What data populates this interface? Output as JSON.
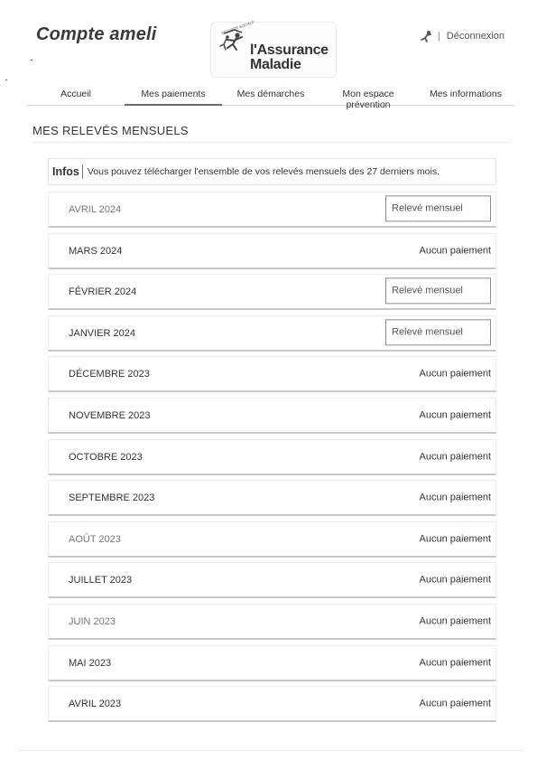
{
  "header": {
    "app_title": "Compte ameli",
    "logo_line1": "l'Assurance",
    "logo_line2": "Maladie",
    "logo_small": "SÉCURITÉ SOCIALE",
    "logout_label": "Déconnexion"
  },
  "nav": {
    "items": [
      {
        "label": "Accueil"
      },
      {
        "label": "Mes paiements"
      },
      {
        "label": "Mes démarches"
      },
      {
        "label": "Mon espace prévention"
      },
      {
        "label": "Mes informations"
      }
    ],
    "active_index": 1
  },
  "page": {
    "title": "MES RELEVÉS MENSUELS"
  },
  "info": {
    "label": "Infos",
    "text": "Vous pouvez télécharger l'ensemble de vos relevés mensuels des 27 derniers mois."
  },
  "months": [
    {
      "label": "AVRIL 2024",
      "action": "Relevé mensuel",
      "has_statement": true
    },
    {
      "label": "MARS 2024",
      "action": "Aucun paiement",
      "has_statement": false
    },
    {
      "label": "FÉVRIER 2024",
      "action": "Relevé mensuel",
      "has_statement": true
    },
    {
      "label": "JANVIER 2024",
      "action": "Relevé mensuel",
      "has_statement": true
    },
    {
      "label": "DÉCEMBRE 2023",
      "action": "Aucun paiement",
      "has_statement": false
    },
    {
      "label": "NOVEMBRE 2023",
      "action": "Aucun paiement",
      "has_statement": false
    },
    {
      "label": "OCTOBRE 2023",
      "action": "Aucun paiement",
      "has_statement": false
    },
    {
      "label": "SEPTEMBRE 2023",
      "action": "Aucun paiement",
      "has_statement": false
    },
    {
      "label": "AOÛT 2023",
      "action": "Aucun paiement",
      "has_statement": false
    },
    {
      "label": "JUILLET 2023",
      "action": "Aucun paiement",
      "has_statement": false
    },
    {
      "label": "JUIN 2023",
      "action": "Aucun paiement",
      "has_statement": false
    },
    {
      "label": "MAI 2023",
      "action": "Aucun paiement",
      "has_statement": false
    },
    {
      "label": "AVRIL 2023",
      "action": "Aucun paiement",
      "has_statement": false
    }
  ],
  "icons": {
    "logo": "assurance-maladie-logo-icon",
    "logout": "logout-person-icon"
  },
  "colors": {
    "text": "#333333",
    "border": "#cfcfcf"
  }
}
